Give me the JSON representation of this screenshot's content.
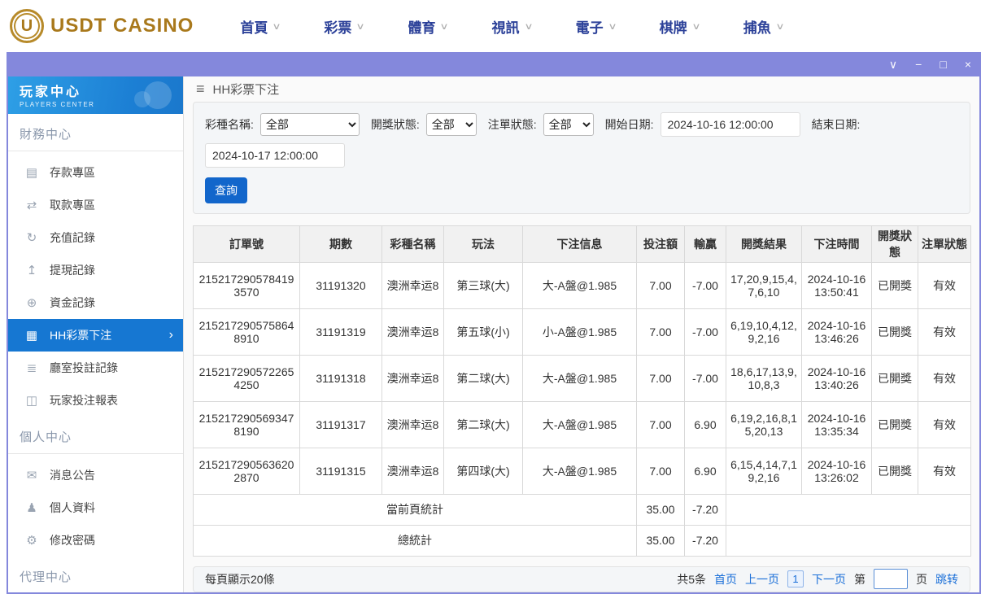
{
  "colors": {
    "titlebar_purple": "#8488dc",
    "sidebar_header_blue_start": "#2e9fe6",
    "sidebar_header_blue_end": "#1c7fd4",
    "active_item_blue": "#1677d2",
    "search_button_blue": "#1266cb",
    "link_blue": "#1a6fd8",
    "logo_gold": "#a9791c",
    "nav_text_blue": "#2c4199"
  },
  "top_nav": {
    "logo_text": "USDT CASINO",
    "logo_glyph": "U",
    "caret_glyph": "∨",
    "items": [
      "首頁",
      "彩票",
      "體育",
      "視訊",
      "電子",
      "棋牌",
      "捕魚"
    ]
  },
  "titlebar": {
    "controls": [
      {
        "name": "window-collapse-icon",
        "glyph": "∨"
      },
      {
        "name": "window-minimize-icon",
        "glyph": "−"
      },
      {
        "name": "window-maximize-icon",
        "glyph": "□"
      },
      {
        "name": "window-close-icon",
        "glyph": "×"
      }
    ]
  },
  "sidebar": {
    "title": "玩家中心",
    "subtitle": "PLAYERS CENTER",
    "active_chevron": "›",
    "sections": [
      {
        "title": "財務中心",
        "items": [
          {
            "label": "存款專區",
            "icon": "deposit-card-icon",
            "glyph": "▤",
            "active": false
          },
          {
            "label": "取款專區",
            "icon": "withdraw-money-icon",
            "glyph": "⇄",
            "active": false
          },
          {
            "label": "充值記錄",
            "icon": "recharge-record-icon",
            "glyph": "↻",
            "active": false
          },
          {
            "label": "提現記錄",
            "icon": "cashout-record-icon",
            "glyph": "↥",
            "active": false
          },
          {
            "label": "資金記錄",
            "icon": "funds-record-icon",
            "glyph": "⊕",
            "active": false
          },
          {
            "label": "HH彩票下注",
            "icon": "lottery-bet-icon",
            "glyph": "▦",
            "active": true
          },
          {
            "label": "廳室投註記錄",
            "icon": "hall-bet-records-icon",
            "glyph": "≣",
            "active": false
          },
          {
            "label": "玩家投注報表",
            "icon": "bet-report-icon",
            "glyph": "◫",
            "active": false
          }
        ]
      },
      {
        "title": "個人中心",
        "items": [
          {
            "label": "消息公告",
            "icon": "bell-icon",
            "glyph": "✉",
            "active": false
          },
          {
            "label": "個人資料",
            "icon": "person-icon",
            "glyph": "♟",
            "active": false
          },
          {
            "label": "修改密碼",
            "icon": "gear-icon",
            "glyph": "⚙",
            "active": false
          }
        ]
      },
      {
        "title": "代理中心",
        "items": []
      }
    ]
  },
  "main": {
    "header": {
      "menu_glyph": "≡",
      "title": "HH彩票下注"
    },
    "filters": {
      "lottery_label": "彩種名稱:",
      "lottery_value": "全部",
      "draw_status_label": "開獎狀態:",
      "draw_status_value": "全部",
      "order_status_label": "注單狀態:",
      "order_status_value": "全部",
      "start_label": "開始日期:",
      "start_value": "2024-10-16 12:00:00",
      "end_label": "結束日期:",
      "end_value": "2024-10-17 12:00:00",
      "search_label": "查詢"
    },
    "table": {
      "headers": [
        "訂單號",
        "期數",
        "彩種名稱",
        "玩法",
        "下注信息",
        "投注額",
        "輸贏",
        "開獎結果",
        "下注時間",
        "開獎狀態",
        "注單狀態"
      ],
      "rows": [
        {
          "order_no": "2152172905784193570",
          "period": "31191320",
          "lottery": "澳洲幸运8",
          "play": "第三球(大)",
          "bet_info": "大-A盤@1.985",
          "bet_amount": "7.00",
          "win_loss": "-7.00",
          "draw_result": "17,20,9,15,4,7,6,10",
          "bet_time": "2024-10-16 13:50:41",
          "draw_status": "已開獎",
          "order_status": "有效"
        },
        {
          "order_no": "2152172905758648910",
          "period": "31191319",
          "lottery": "澳洲幸运8",
          "play": "第五球(小)",
          "bet_info": "小-A盤@1.985",
          "bet_amount": "7.00",
          "win_loss": "-7.00",
          "draw_result": "6,19,10,4,12,9,2,16",
          "bet_time": "2024-10-16 13:46:26",
          "draw_status": "已開獎",
          "order_status": "有效"
        },
        {
          "order_no": "2152172905722654250",
          "period": "31191318",
          "lottery": "澳洲幸运8",
          "play": "第二球(大)",
          "bet_info": "大-A盤@1.985",
          "bet_amount": "7.00",
          "win_loss": "-7.00",
          "draw_result": "18,6,17,13,9,10,8,3",
          "bet_time": "2024-10-16 13:40:26",
          "draw_status": "已開獎",
          "order_status": "有效"
        },
        {
          "order_no": "2152172905693478190",
          "period": "31191317",
          "lottery": "澳洲幸运8",
          "play": "第二球(大)",
          "bet_info": "大-A盤@1.985",
          "bet_amount": "7.00",
          "win_loss": "6.90",
          "draw_result": "6,19,2,16,8,15,20,13",
          "bet_time": "2024-10-16 13:35:34",
          "draw_status": "已開獎",
          "order_status": "有效"
        },
        {
          "order_no": "2152172905636202870",
          "period": "31191315",
          "lottery": "澳洲幸运8",
          "play": "第四球(大)",
          "bet_info": "大-A盤@1.985",
          "bet_amount": "7.00",
          "win_loss": "6.90",
          "draw_result": "6,15,4,14,7,19,2,16",
          "bet_time": "2024-10-16 13:26:02",
          "draw_status": "已開獎",
          "order_status": "有效"
        }
      ],
      "summary": [
        {
          "label": "當前頁統計",
          "bet_amount": "35.00",
          "win_loss": "-7.20"
        },
        {
          "label": "總統計",
          "bet_amount": "35.00",
          "win_loss": "-7.20"
        }
      ]
    },
    "pagination": {
      "per_page": "每頁顯示20條",
      "total": "共5条",
      "first": "首页",
      "prev": "上一页",
      "current_page": "1",
      "next": "下一页",
      "page_prefix": "第",
      "page_input_value": "",
      "page_suffix": "页",
      "jump": "跳转"
    }
  }
}
